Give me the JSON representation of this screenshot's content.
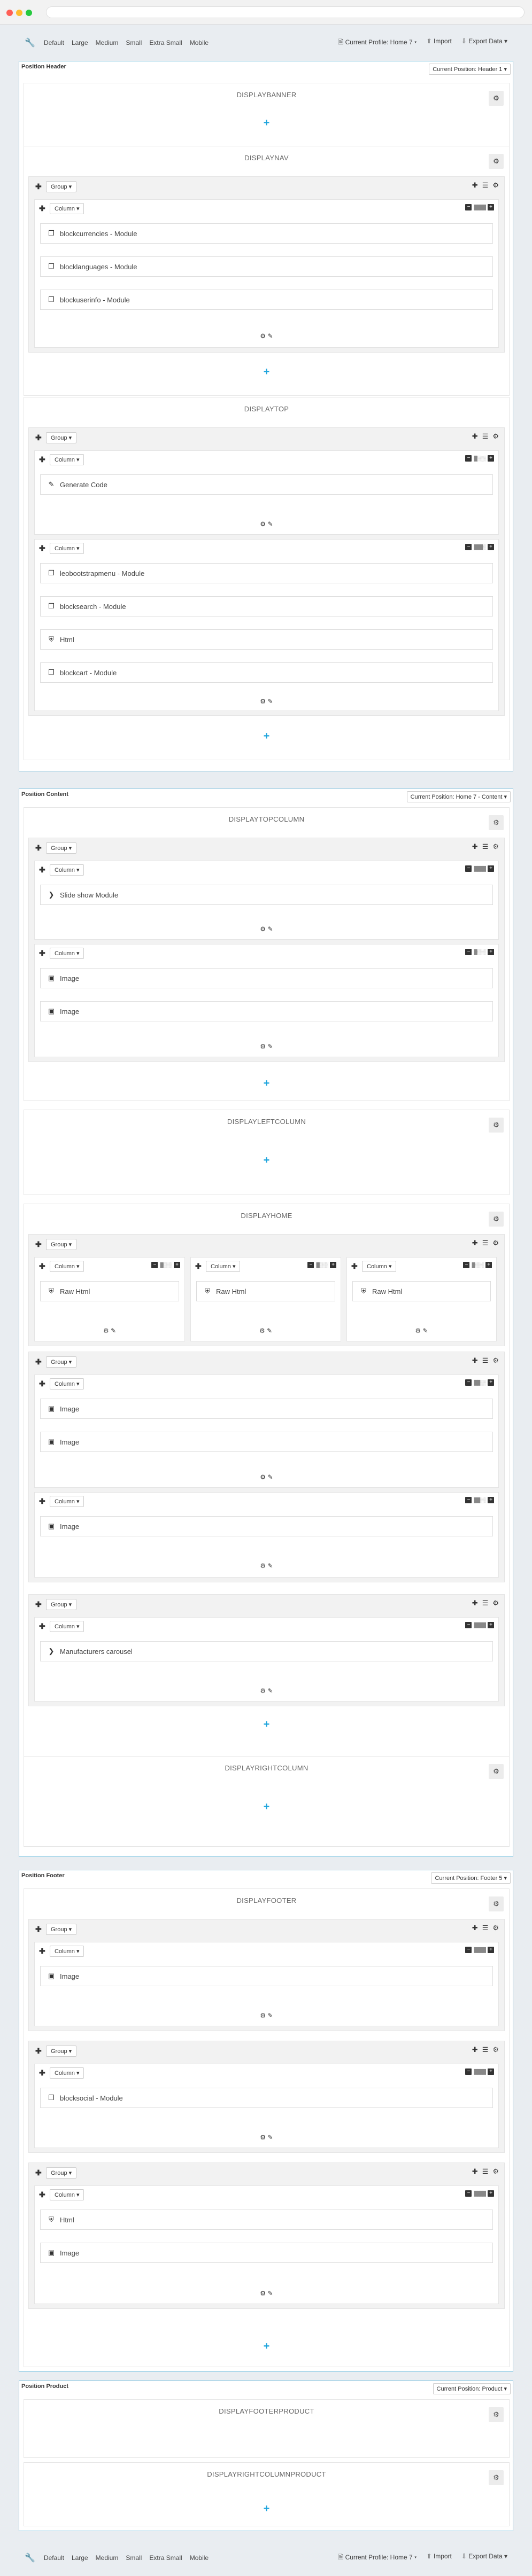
{
  "toolbar": {
    "sizes": [
      "Default",
      "Large",
      "Medium",
      "Small",
      "Extra Small",
      "Mobile"
    ],
    "profile": "Current Profile: Home 7 ▾",
    "import": "Import",
    "export": "Export Data ▾"
  },
  "labels": {
    "group": "Group ▾",
    "column": "Column ▾"
  },
  "positions": {
    "header": {
      "title": "Position Header",
      "select": "Current Position: Header 1 ▾"
    },
    "content": {
      "title": "Position Content",
      "select": "Current Position: Home 7 - Content ▾"
    },
    "footer": {
      "title": "Position Footer",
      "select": "Current Position: Footer 5 ▾"
    },
    "product": {
      "title": "Position Product",
      "select": "Current Position: Product ▾"
    }
  },
  "hooks": {
    "displaybanner": "DISPLAYBANNER",
    "displaynav": "DISPLAYNAV",
    "displaytop": "DISPLAYTOP",
    "displaytopcolumn": "DISPLAYTOPCOLUMN",
    "displayleftcolumn": "DISPLAYLEFTCOLUMN",
    "displayhome": "DISPLAYHOME",
    "displayrightcolumn": "DISPLAYRIGHTCOLUMN",
    "displayfooter": "DISPLAYFOOTER",
    "displayfooterproduct": "DISPLAYFOOTERPRODUCT",
    "displayrightcolumnproduct": "DISPLAYRIGHTCOLUMNPRODUCT"
  },
  "modules": {
    "blockcurrencies": "blockcurrencies - Module",
    "blocklanguages": "blocklanguages - Module",
    "blockuserinfo": "blockuserinfo - Module",
    "generate_code": "Generate Code",
    "leobootstrapmenu": "leobootstrapmenu - Module",
    "blocksearch": "blocksearch - Module",
    "html": "Html",
    "blockcart": "blockcart - Module",
    "slideshow": "Slide show Module",
    "image": "Image",
    "raw_html": "Raw Html",
    "manufacturers": "Manufacturers carousel",
    "blocksocial": "blocksocial - Module"
  },
  "icons": {
    "wrench": "wrench-icon",
    "move": "move-icon",
    "gear": "gear-icon",
    "plus": "plus-icon",
    "module": "module-icon",
    "edit": "edit-icon",
    "image": "image-icon",
    "html": "html5-icon",
    "chevron": "chevron-right-icon",
    "import": "upload-icon",
    "export": "download-icon"
  },
  "accent": "#1ea4dc",
  "border_accent": "#8cc9e2"
}
